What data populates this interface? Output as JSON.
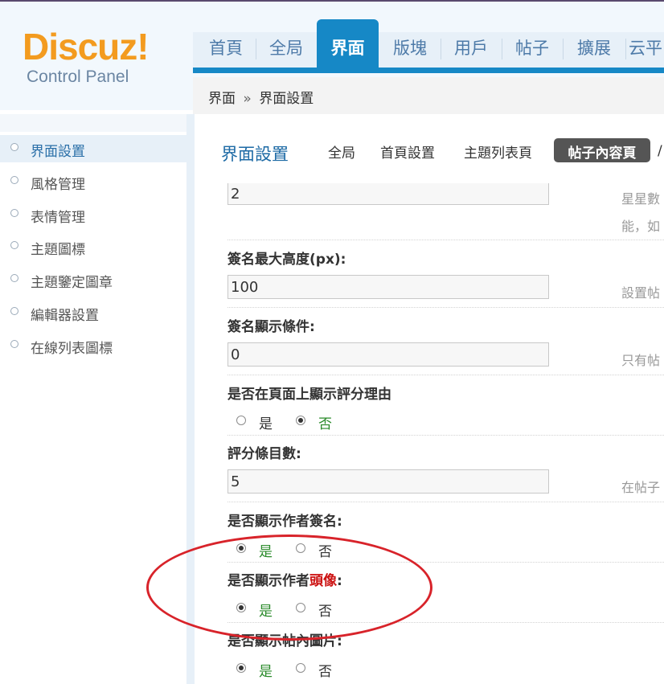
{
  "logo": {
    "main": "Discuz!",
    "sub": "Control Panel"
  },
  "nav": {
    "items": [
      "首頁",
      "全局",
      "界面",
      "版塊",
      "用戶",
      "帖子",
      "擴展",
      "云平"
    ],
    "active": "界面"
  },
  "breadcrumb": {
    "root": "界面",
    "sep": "»",
    "current": "界面設置"
  },
  "sidebar": {
    "items": [
      "界面設置",
      "風格管理",
      "表情管理",
      "主題圖標",
      "主題鑒定圖章",
      "編輯器設置",
      "在線列表圖標"
    ],
    "active": "界面設置"
  },
  "section": {
    "title": "界面設置",
    "tabs": [
      "全局",
      "首頁設置",
      "主題列表頁",
      "帖子內容頁"
    ],
    "active_tab": "帖子內容頁",
    "tab_overflow": "/"
  },
  "form": {
    "star_value": "2",
    "star_hint_1": "星星數",
    "star_hint_2": "能，如",
    "sig_height": {
      "label": "簽名最大高度(px):",
      "value": "100",
      "hint": "設置帖"
    },
    "sig_condition": {
      "label": "簽名顯示條件:",
      "value": "0",
      "hint": "只有帖"
    },
    "rate_reason": {
      "label": "是否在頁面上顯示評分理由",
      "yes": "是",
      "no": "否"
    },
    "rate_count": {
      "label": "評分條目數:",
      "value": "5",
      "hint": "在帖子"
    },
    "author_sig": {
      "label": "是否顯示作者簽名:",
      "yes": "是",
      "no": "否"
    },
    "author_avatar": {
      "label_prefix": "是否顯示作者",
      "label_highlight": "頭像",
      "label_suffix": ":",
      "yes": "是",
      "no": "否"
    },
    "post_images": {
      "label": "是否顯示帖內圖片:",
      "yes": "是",
      "no": "否"
    }
  },
  "colors": {
    "accent": "#1688c6",
    "logo": "#f39b1f",
    "highlight_circle": "#d8232a"
  }
}
